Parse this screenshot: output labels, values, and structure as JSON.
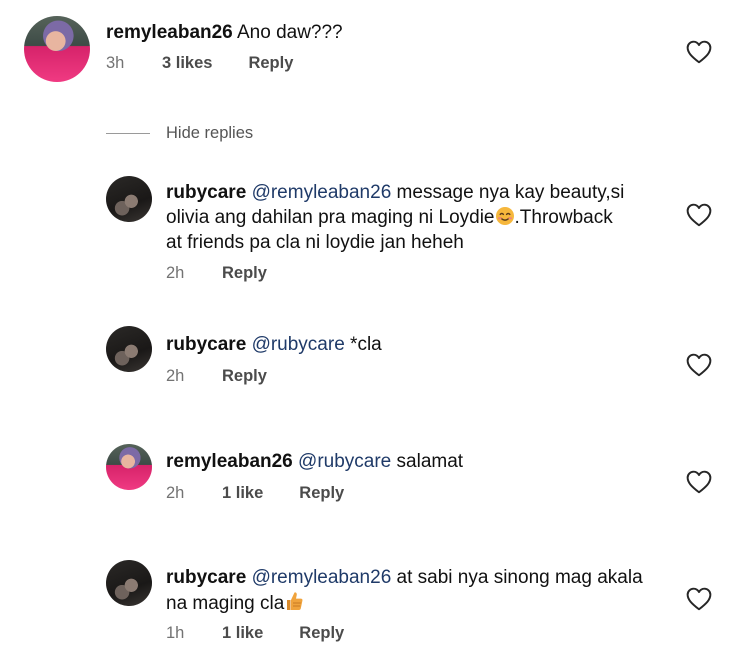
{
  "comments": [
    {
      "username": "remyleaban26",
      "mention": "",
      "text": "Ano daw???",
      "time": "3h",
      "likes": "3 likes",
      "reply_label": "Reply"
    }
  ],
  "hide_replies_label": "Hide replies",
  "replies": [
    {
      "username": "rubycare",
      "mention": "@remyleaban26",
      "text_line1": " message nya kay beauty,si",
      "text_line2": "olivia ang dahilan pra maging ni Loydie",
      "emoji1": "smiling-face-emoji",
      "text_line2b": ".Throwback",
      "text_line3": "at friends pa cla ni loydie jan heheh",
      "time": "2h",
      "likes": "",
      "reply_label": "Reply"
    },
    {
      "username": "rubycare",
      "mention": "@rubycare",
      "text_line1": " *cla",
      "time": "2h",
      "likes": "",
      "reply_label": "Reply"
    },
    {
      "username": "remyleaban26",
      "mention": "@rubycare",
      "text_line1": " salamat",
      "time": "2h",
      "likes": "1 like",
      "reply_label": "Reply"
    },
    {
      "username": "rubycare",
      "mention": "@remyleaban26",
      "text_line1": " at sabi nya sinong mag akala",
      "text_line2": "na maging cla",
      "emoji2": "thumbs-up-emoji",
      "time": "1h",
      "likes": "1 like",
      "reply_label": "Reply"
    }
  ],
  "colors": {
    "text": "#111111",
    "meta": "#737373",
    "mention": "#1f3a68"
  }
}
